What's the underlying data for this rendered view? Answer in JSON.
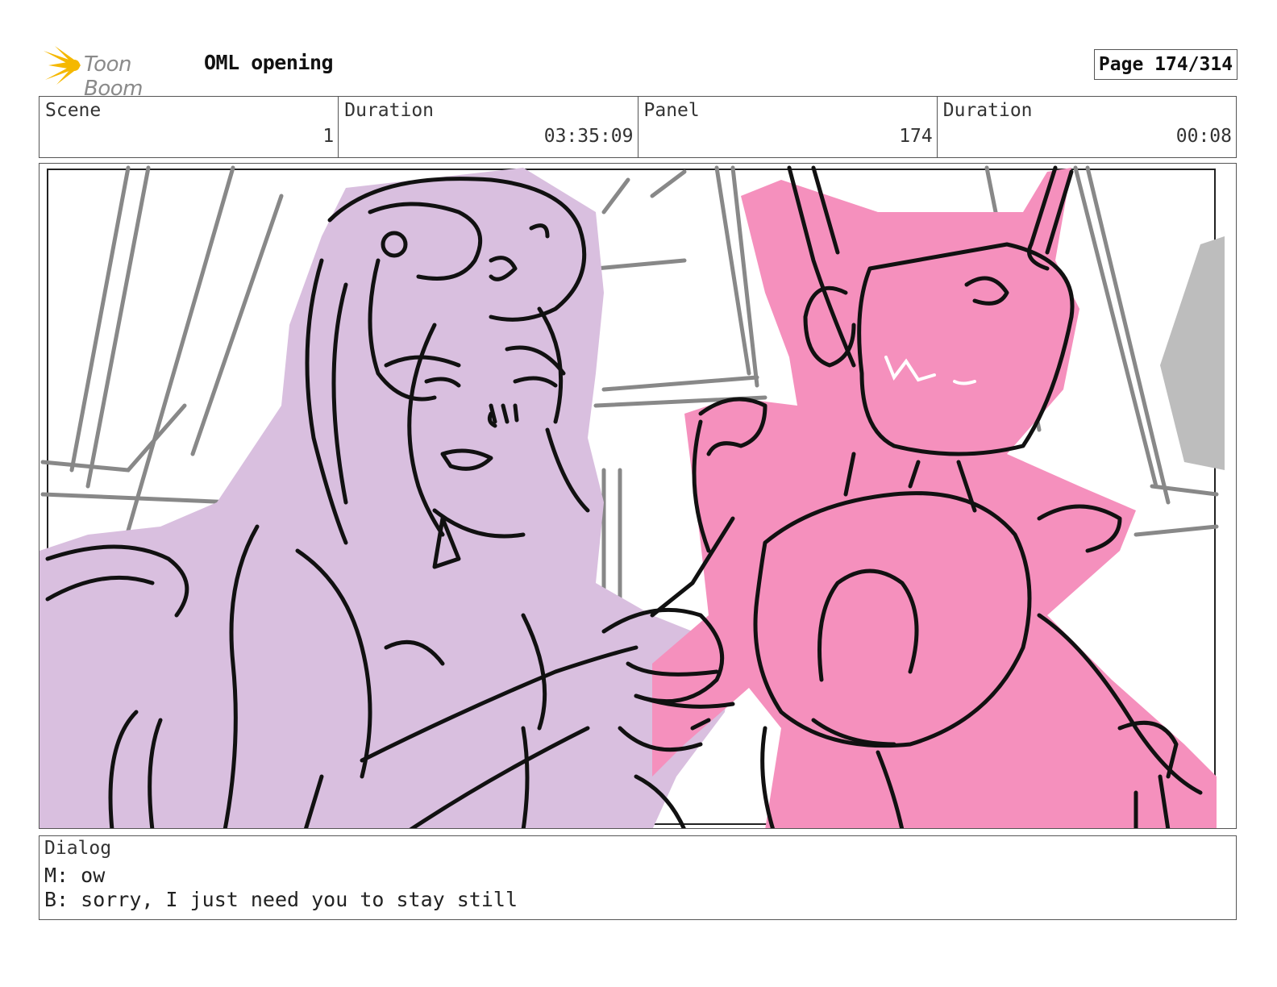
{
  "header": {
    "logo_text": "Toon Boom",
    "project_title": "OML opening",
    "page_label": "Page 174/314"
  },
  "info": {
    "scene": {
      "label": "Scene",
      "value": "1"
    },
    "scene_duration": {
      "label": "Duration",
      "value": "03:35:09"
    },
    "panel": {
      "label": "Panel",
      "value": "174"
    },
    "panel_duration": {
      "label": "Duration",
      "value": "00:08"
    }
  },
  "drawing": {
    "colors": {
      "left_character": "#d9bfdf",
      "right_character": "#f590bd",
      "ink": "#111111",
      "background_lines": "#888888"
    },
    "face_doodle": "\\/\\ ~"
  },
  "dialog": {
    "label": "Dialog",
    "lines": [
      "M: ow",
      "B: sorry, I just need you to stay still"
    ]
  }
}
